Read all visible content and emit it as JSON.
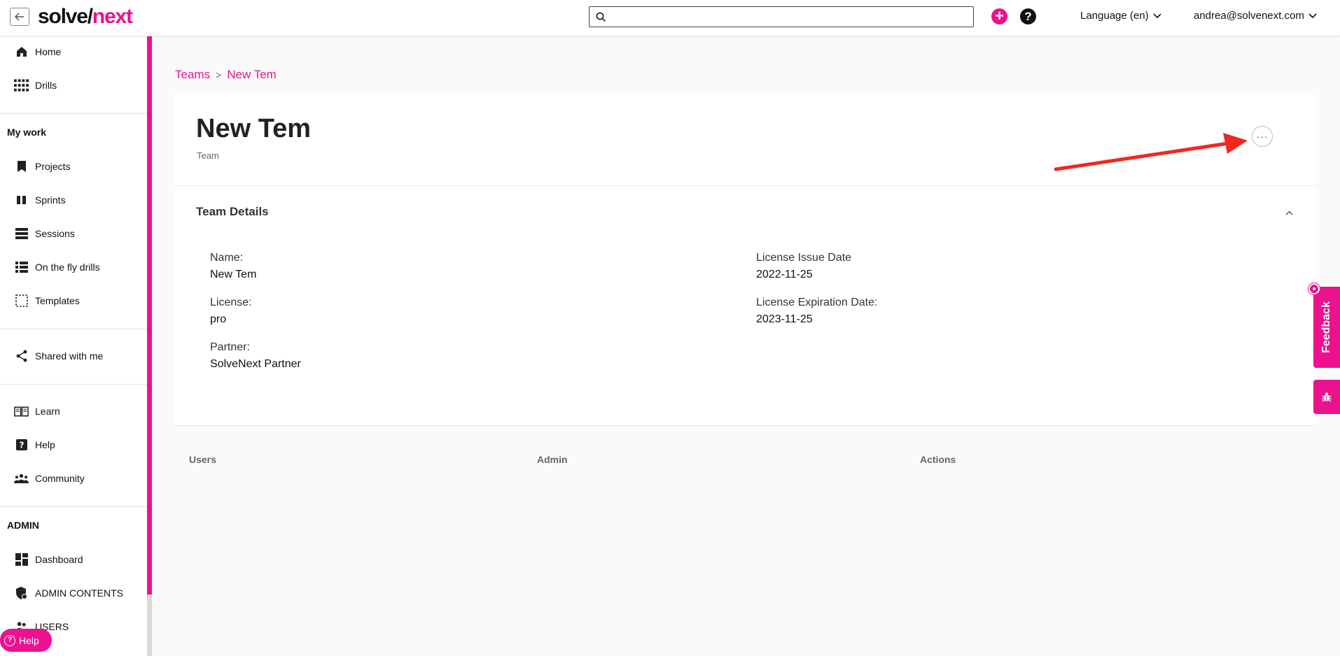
{
  "app": {
    "logo_part1": "solve/",
    "logo_part2": "next"
  },
  "topbar": {
    "language": "Language (en)",
    "user": "andrea@solvenext.com"
  },
  "sidebar": {
    "items_top": [
      {
        "label": "Home",
        "icon": "home-icon"
      },
      {
        "label": "Drills",
        "icon": "grid-icon"
      }
    ],
    "my_work_title": "My work",
    "my_work": [
      {
        "label": "Projects",
        "icon": "bookmark-icon"
      },
      {
        "label": "Sprints",
        "icon": "sprint-icon"
      },
      {
        "label": "Sessions",
        "icon": "sessions-icon"
      },
      {
        "label": "On the fly drills",
        "icon": "list-icon"
      },
      {
        "label": "Templates",
        "icon": "template-icon"
      }
    ],
    "shared": {
      "label": "Shared with me",
      "icon": "share-icon"
    },
    "support": [
      {
        "label": "Learn",
        "icon": "book-icon"
      },
      {
        "label": "Help",
        "icon": "help-icon"
      },
      {
        "label": "Community",
        "icon": "community-icon"
      }
    ],
    "admin_title": "ADMIN",
    "admin": [
      {
        "label": "Dashboard",
        "icon": "dashboard-icon"
      },
      {
        "label": "ADMIN CONTENTS",
        "icon": "shield-icon"
      },
      {
        "label": "USERS",
        "icon": "users-icon"
      }
    ],
    "help_pill": "Help"
  },
  "breadcrumb": {
    "parent": "Teams",
    "current": "New Tem"
  },
  "team": {
    "title": "New Tem",
    "subtitle": "Team",
    "section_title": "Team Details",
    "fields": {
      "name_label": "Name:",
      "name_value": "New Tem",
      "license_label": "License:",
      "license_value": "pro",
      "partner_label": "Partner:",
      "partner_value": "SolveNext Partner",
      "issue_label": "License Issue Date",
      "issue_value": "2022-11-25",
      "expiration_label": "License Expiration Date:",
      "expiration_value": "2023-11-25"
    }
  },
  "table": {
    "columns": [
      "Users",
      "Admin",
      "Actions"
    ]
  },
  "side_tabs": {
    "feedback": "Feedback"
  },
  "colors": {
    "accent": "#ec118f",
    "annotation_arrow": "#f0281e"
  }
}
